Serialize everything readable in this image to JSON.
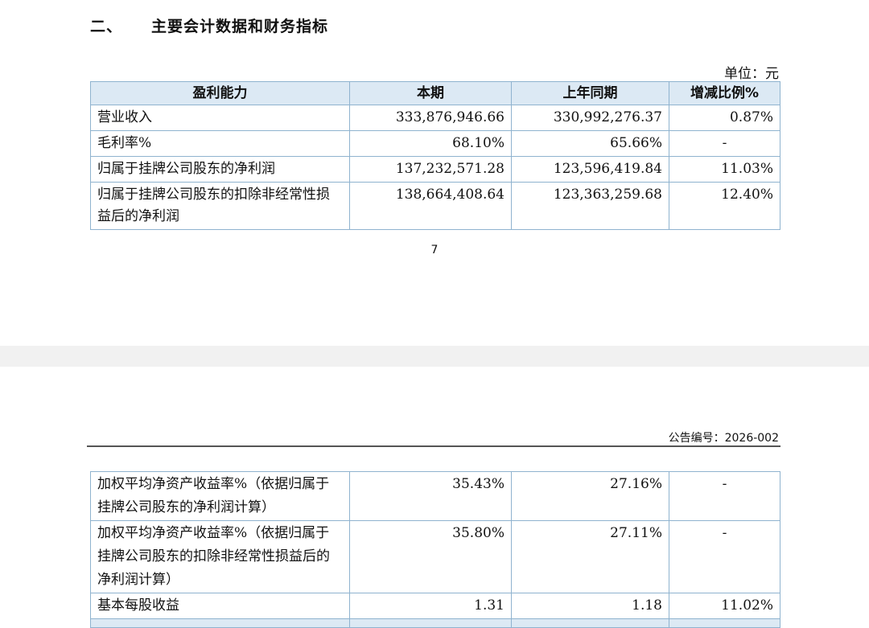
{
  "section": {
    "number": "二、",
    "title": "主要会计数据和财务指标"
  },
  "unit_label": "单位：元",
  "table1": {
    "headers": [
      "盈利能力",
      "本期",
      "上年同期",
      "增减比例%"
    ],
    "rows": [
      [
        "营业收入",
        "333,876,946.66",
        "330,992,276.37",
        "0.87%"
      ],
      [
        "毛利率%",
        "68.10%",
        "65.66%",
        "-"
      ],
      [
        "归属于挂牌公司股东的净利润",
        "137,232,571.28",
        "123,596,419.84",
        "11.03%"
      ],
      [
        "归属于挂牌公司股东的扣除非经常性损益后的净利润",
        "138,664,408.64",
        "123,363,259.68",
        "12.40%"
      ]
    ]
  },
  "page_number": "7",
  "notice_number": "公告编号：2026-002",
  "table2": {
    "rows": [
      [
        "加权平均净资产收益率%（依据归属于挂牌公司股东的净利润计算）",
        "35.43%",
        "27.16%",
        "-"
      ],
      [
        "加权平均净资产收益率%（依据归属于挂牌公司股东的扣除非经常性损益后的净利润计算）",
        "35.80%",
        "27.11%",
        "-"
      ],
      [
        "基本每股收益",
        "1.31",
        "1.18",
        "11.02%"
      ]
    ]
  }
}
